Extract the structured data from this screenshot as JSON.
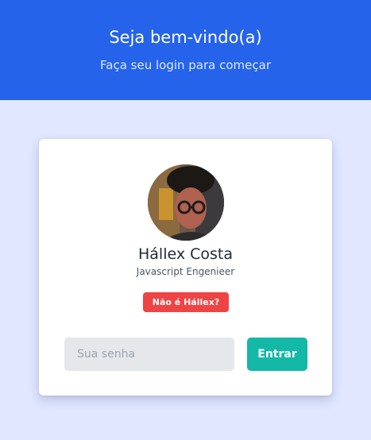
{
  "header": {
    "title": "Seja bem-vindo(a)",
    "subtitle": "Faça seu login para começar"
  },
  "profile": {
    "avatar_icon": "user-photo",
    "name": "Hállex Costa",
    "role": "Javascript Engenieer",
    "not_user_label": "Não é Hállex?"
  },
  "login": {
    "password_placeholder": "Sua senha",
    "password_value": "",
    "submit_label": "Entrar"
  },
  "colors": {
    "header_bg": "#2563eb",
    "page_bg": "#e0e7ff",
    "danger": "#ef4444",
    "primary_action": "#14b8a6"
  }
}
